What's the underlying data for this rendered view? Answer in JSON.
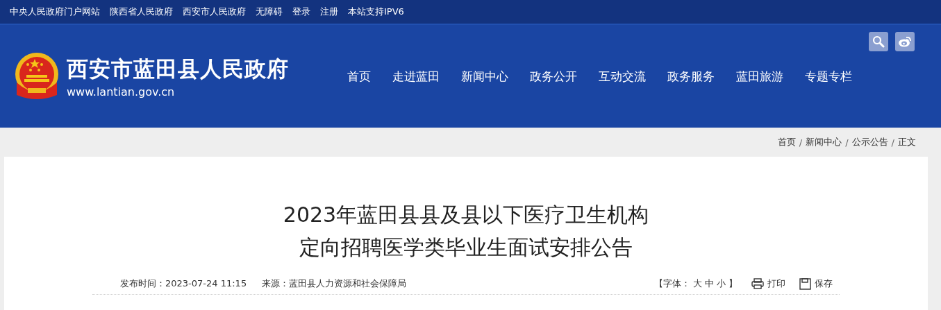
{
  "top_links": [
    "中央人民政府门户网站",
    "陕西省人民政府",
    "西安市人民政府",
    "无障碍",
    "登录",
    "注册",
    "本站支持IPV6"
  ],
  "site": {
    "name": "西安市蓝田县人民政府",
    "url": "www.lantian.gov.cn"
  },
  "nav": [
    "首页",
    "走进蓝田",
    "新闻中心",
    "政务公开",
    "互动交流",
    "政务服务",
    "蓝田旅游",
    "专题专栏"
  ],
  "breadcrumb": [
    {
      "label": "首页"
    },
    {
      "separator": "/",
      "label": "新闻中心"
    },
    {
      "separator": "/",
      "label": "公示公告"
    },
    {
      "separator": "/",
      "label": "正文"
    }
  ],
  "article": {
    "title_lines": [
      "2023年蓝田县县及县以下医疗卫生机构",
      "定向招聘医学类毕业生面试安排公告"
    ],
    "published": "发布时间：2023-07-24 11:15",
    "source": "来源：蓝田县人力资源和社会保障局",
    "font_size": {
      "label": "【字体：",
      "options": [
        "大",
        "中",
        "小"
      ],
      "close": "】"
    },
    "print": "打印",
    "save": "保存"
  }
}
